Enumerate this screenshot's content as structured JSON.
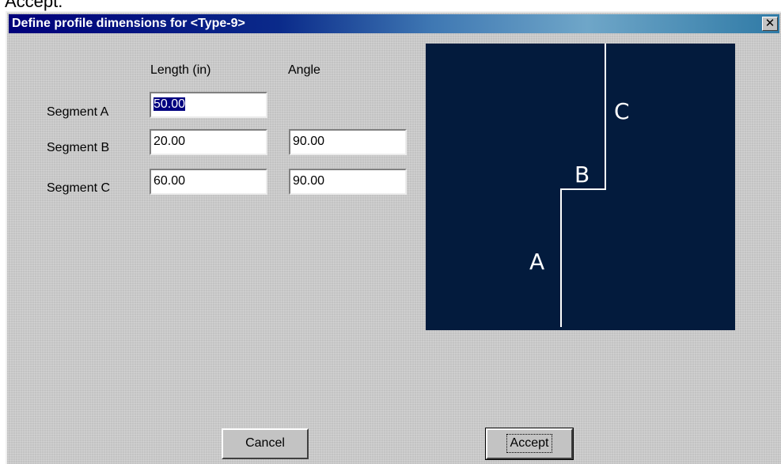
{
  "top_text": "Accept.",
  "window": {
    "title": "Define profile dimensions for <Type-9>",
    "close_glyph": "✕"
  },
  "columns": {
    "length": "Length (in)",
    "angle": "Angle"
  },
  "segments": [
    {
      "label": "Segment A",
      "length": "50.00",
      "angle": null
    },
    {
      "label": "Segment B",
      "length": "20.00",
      "angle": "90.00"
    },
    {
      "label": "Segment C",
      "length": "60.00",
      "angle": "90.00"
    }
  ],
  "preview": {
    "background": "#031b3d",
    "line_color": "#ffffff",
    "labels": {
      "a": "A",
      "b": "B",
      "c": "C"
    }
  },
  "buttons": {
    "cancel": "Cancel",
    "accept": "Accept"
  }
}
